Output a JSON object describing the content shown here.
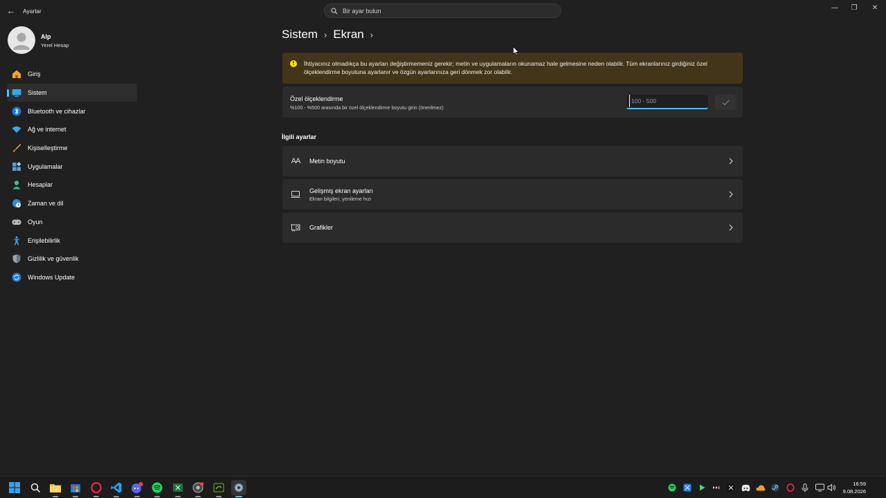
{
  "window": {
    "back_glyph": "←",
    "title": "Ayarlar",
    "minimize_glyph": "—",
    "maximize_glyph": "❐",
    "close_glyph": "✕"
  },
  "search": {
    "placeholder": "Bir ayar bulun",
    "value": ""
  },
  "profile": {
    "name": "Alp",
    "subtitle": "Yerel Hesap"
  },
  "nav": {
    "items": [
      {
        "label": "Giriş",
        "icon": "home-icon",
        "active": false
      },
      {
        "label": "Sistem",
        "icon": "system-icon",
        "active": true
      },
      {
        "label": "Bluetooth ve cihazlar",
        "icon": "bluetooth-icon",
        "active": false
      },
      {
        "label": "Ağ ve internet",
        "icon": "wifi-icon",
        "active": false
      },
      {
        "label": "Kişiselleştirme",
        "icon": "brush-icon",
        "active": false
      },
      {
        "label": "Uygulamalar",
        "icon": "apps-icon",
        "active": false
      },
      {
        "label": "Hesaplar",
        "icon": "account-icon",
        "active": false
      },
      {
        "label": "Zaman ve dil",
        "icon": "globe-clock-icon",
        "active": false
      },
      {
        "label": "Oyun",
        "icon": "gamepad-icon",
        "active": false
      },
      {
        "label": "Erişilebilirlik",
        "icon": "accessibility-icon",
        "active": false
      },
      {
        "label": "Gizlilik ve güvenlik",
        "icon": "shield-icon",
        "active": false
      },
      {
        "label": "Windows Update",
        "icon": "update-icon",
        "active": false
      }
    ]
  },
  "breadcrumb": {
    "part1": "Sistem",
    "separator": "›",
    "part2": "Ekran",
    "trailing": "›"
  },
  "warning": {
    "icon": "warning-icon",
    "glyph": "!",
    "text": "İhtiyacınız olmadıkça bu ayarları değiştirmemeniz gerekir; metin ve uygulamaların okunamaz hale gelmesine neden olabilir. Tüm ekranlarınız girdiğiniz özel ölçeklendirme boyutuna ayarlanır ve özgün ayarlarınıza geri dönmek zor olabilir."
  },
  "custom_scaling": {
    "title": "Özel ölçeklendirme",
    "description": "%100 - %500 arasında bir özel ölçeklendirme boyutu girin (önerilmez)",
    "input_placeholder": "100 - 500",
    "input_value": ""
  },
  "related": {
    "heading": "İlgili ayarlar",
    "items": [
      {
        "title": "Metin boyutu",
        "subtitle": "",
        "icon": "text-size-icon",
        "glyph": "AA"
      },
      {
        "title": "Gelişmiş ekran ayarları",
        "subtitle": "Ekran bilgileri, yenileme hızı",
        "icon": "monitor-icon",
        "glyph": ""
      },
      {
        "title": "Grafikler",
        "subtitle": "",
        "icon": "graphics-card-icon",
        "glyph": ""
      }
    ]
  },
  "taskbar": {
    "apps": [
      "windows-start-icon",
      "search-icon",
      "file-explorer-icon",
      "store-icon",
      "opera-gx-icon",
      "vscode-icon",
      "discord-icon",
      "spotify-icon",
      "excel-icon",
      "chrome-icon",
      "nvidia-icon",
      "settings-icon"
    ],
    "tray": [
      "spotify-tray-icon",
      "app-tray-icon",
      "play-tray-icon",
      "media-tray-icon",
      "x-tray-icon",
      "discord-tray-icon",
      "cloud-tray-icon",
      "steam-tray-icon",
      "opera-tray-icon",
      "microphone-icon",
      "network-icon",
      "volume-icon"
    ],
    "time": "16:59",
    "date": "9.08.2026"
  },
  "colors": {
    "accent": "#4cc2ff",
    "warning_bg": "#433519",
    "warning_icon": "#fce100",
    "background": "#202020",
    "card": "#2b2b2b"
  }
}
